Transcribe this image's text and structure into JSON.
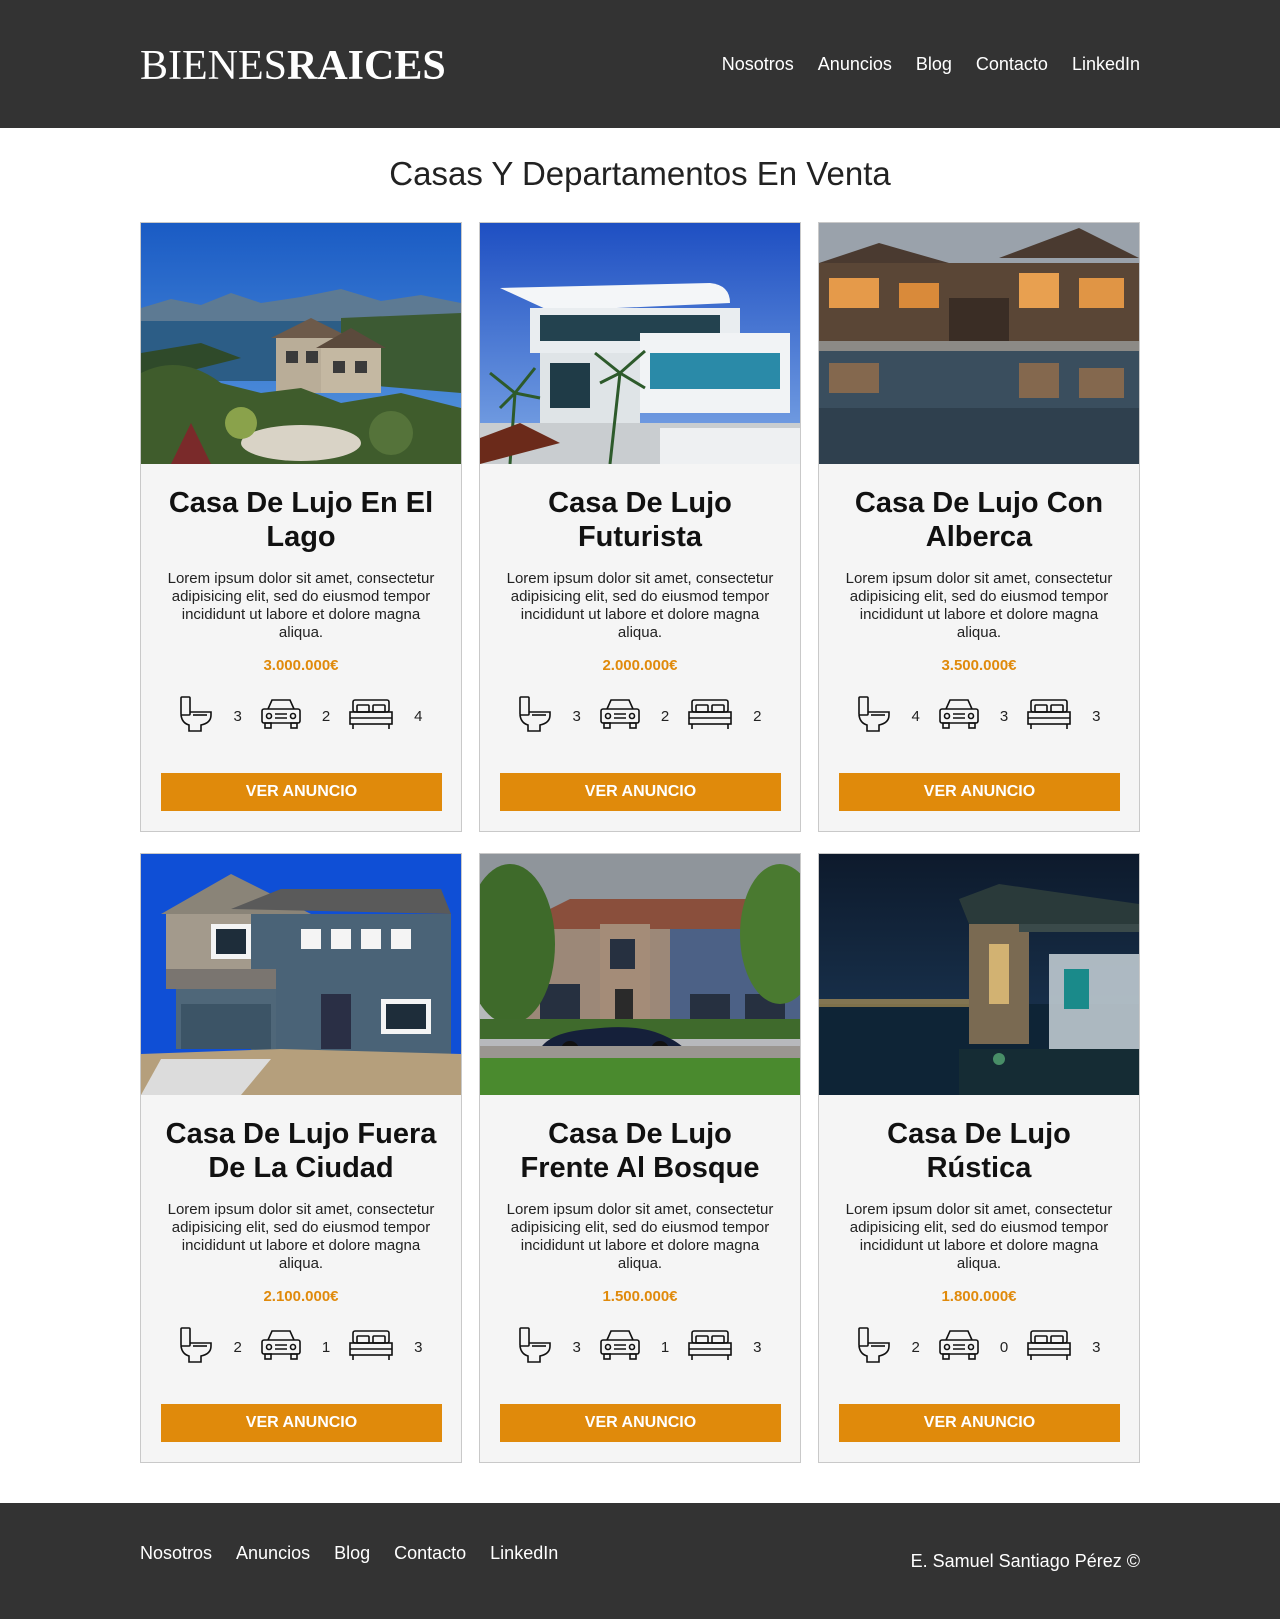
{
  "header": {
    "logo_light": "BIENES",
    "logo_bold": "RAICES",
    "nav": [
      "Nosotros",
      "Anuncios",
      "Blog",
      "Contacto",
      "LinkedIn"
    ]
  },
  "main": {
    "title": "Casas Y Departamentos En Venta",
    "cards": [
      {
        "title": "Casa De Lujo En El Lago",
        "image": "lake-house-photo",
        "description": "Lorem ipsum dolor sit amet, consectetur adipisicing elit, sed do eiusmod tempor incididunt ut labore et dolore magna aliqua.",
        "price": "3.000.000€",
        "bathrooms": "3",
        "parking": "2",
        "bedrooms": "4",
        "button": "VER ANUNCIO"
      },
      {
        "title": "Casa De Lujo Futurista",
        "image": "futuristic-house-photo",
        "description": "Lorem ipsum dolor sit amet, consectetur adipisicing elit, sed do eiusmod tempor incididunt ut labore et dolore magna aliqua.",
        "price": "2.000.000€",
        "bathrooms": "3",
        "parking": "2",
        "bedrooms": "2",
        "button": "VER ANUNCIO"
      },
      {
        "title": "Casa De Lujo Con Alberca",
        "image": "pool-house-photo",
        "description": "Lorem ipsum dolor sit amet, consectetur adipisicing elit, sed do eiusmod tempor incididunt ut labore et dolore magna aliqua.",
        "price": "3.500.000€",
        "bathrooms": "4",
        "parking": "3",
        "bedrooms": "3",
        "button": "VER ANUNCIO"
      },
      {
        "title": "Casa De Lujo Fuera De La Ciudad",
        "image": "suburban-house-photo",
        "description": "Lorem ipsum dolor sit amet, consectetur adipisicing elit, sed do eiusmod tempor incididunt ut labore et dolore magna aliqua.",
        "price": "2.100.000€",
        "bathrooms": "2",
        "parking": "1",
        "bedrooms": "3",
        "button": "VER ANUNCIO"
      },
      {
        "title": "Casa De Lujo Frente Al Bosque",
        "image": "brick-house-photo",
        "description": "Lorem ipsum dolor sit amet, consectetur adipisicing elit, sed do eiusmod tempor incididunt ut labore et dolore magna aliqua.",
        "price": "1.500.000€",
        "bathrooms": "3",
        "parking": "1",
        "bedrooms": "3",
        "button": "VER ANUNCIO"
      },
      {
        "title": "Casa De Lujo Rústica",
        "image": "night-house-photo",
        "description": "Lorem ipsum dolor sit amet, consectetur adipisicing elit, sed do eiusmod tempor incididunt ut labore et dolore magna aliqua.",
        "price": "1.800.000€",
        "bathrooms": "2",
        "parking": "0",
        "bedrooms": "3",
        "button": "VER ANUNCIO"
      }
    ]
  },
  "footer": {
    "nav": [
      "Nosotros",
      "Anuncios",
      "Blog",
      "Contacto",
      "LinkedIn"
    ],
    "copyright": "E. Samuel Santiago Pérez ©"
  },
  "colors": {
    "header_bg": "#333333",
    "accent": "#e08a0b",
    "card_bg": "#f5f5f5"
  }
}
